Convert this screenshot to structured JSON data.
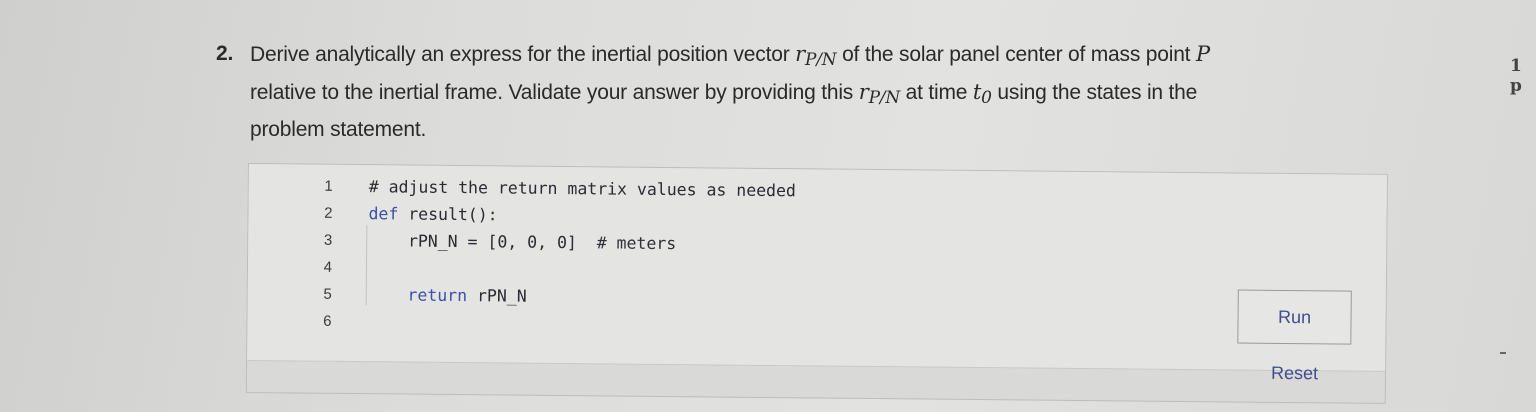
{
  "question": {
    "number": "2.",
    "line1_prefix": "Derive analytically an express for the inertial position vector ",
    "r_symbol": "r",
    "subscript": "P/N",
    "line1_mid": " of the  solar panel center of mass point ",
    "point_symbol": "P",
    "line2_prefix": "relative to the inertial frame. Validate your answer by providing this ",
    "line2_mid": " at time ",
    "t_symbol": "t",
    "t_sub": "0",
    "line2_suffix": " using the states in the",
    "line3": "problem statement."
  },
  "points_label": "1 p",
  "editor": {
    "line_numbers": [
      "1",
      "2",
      "3",
      "4",
      "5",
      "6"
    ],
    "lines": {
      "l1": "# adjust the return matrix values as needed",
      "l2_kw": "def",
      "l2_rest": " result():",
      "l3_code": "    rPN_N = [0, 0, 0]",
      "l3_comment": "  # meters",
      "l4": "",
      "l5_kw": "    return",
      "l5_rest": " rPN_N",
      "l6": ""
    }
  },
  "buttons": {
    "run": "Run",
    "reset": "Reset"
  }
}
